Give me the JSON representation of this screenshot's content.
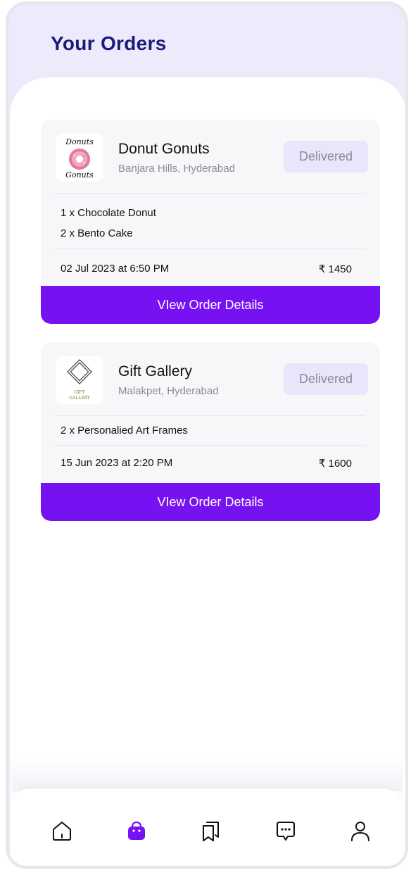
{
  "header": {
    "title": "Your Orders"
  },
  "orders": [
    {
      "shop_name": "Donut Gonuts",
      "location": "Banjara Hills, Hyderabad",
      "status": "Delivered",
      "logo_lines": [
        "Donuts",
        "Gonuts"
      ],
      "items": [
        "1  x Chocolate Donut",
        "2 x Bento Cake"
      ],
      "date": "02 Jul 2023 at 6:50 PM",
      "price": "₹ 1450",
      "button_label": "VIew Order Details"
    },
    {
      "shop_name": "Gift Gallery",
      "location": "Malakpet, Hyderabad",
      "status": "Delivered",
      "logo_lines": [
        "GIFT",
        "GALLERY"
      ],
      "items": [
        "2 x Personalied Art Frames"
      ],
      "date": "15 Jun 2023 at 2:20 PM",
      "price": "₹ 1600",
      "button_label": "VIew Order Details"
    }
  ],
  "bottom_nav": {
    "items": [
      {
        "icon": "home-icon",
        "active": false
      },
      {
        "icon": "shopping-bag-icon",
        "active": true
      },
      {
        "icon": "bookmarks-icon",
        "active": false
      },
      {
        "icon": "chat-icon",
        "active": false
      },
      {
        "icon": "profile-icon",
        "active": false
      }
    ]
  },
  "colors": {
    "accent": "#7611f2",
    "title": "#1a1b7d",
    "header_bg": "#eceafb",
    "status_bg": "#e7e6fb"
  }
}
